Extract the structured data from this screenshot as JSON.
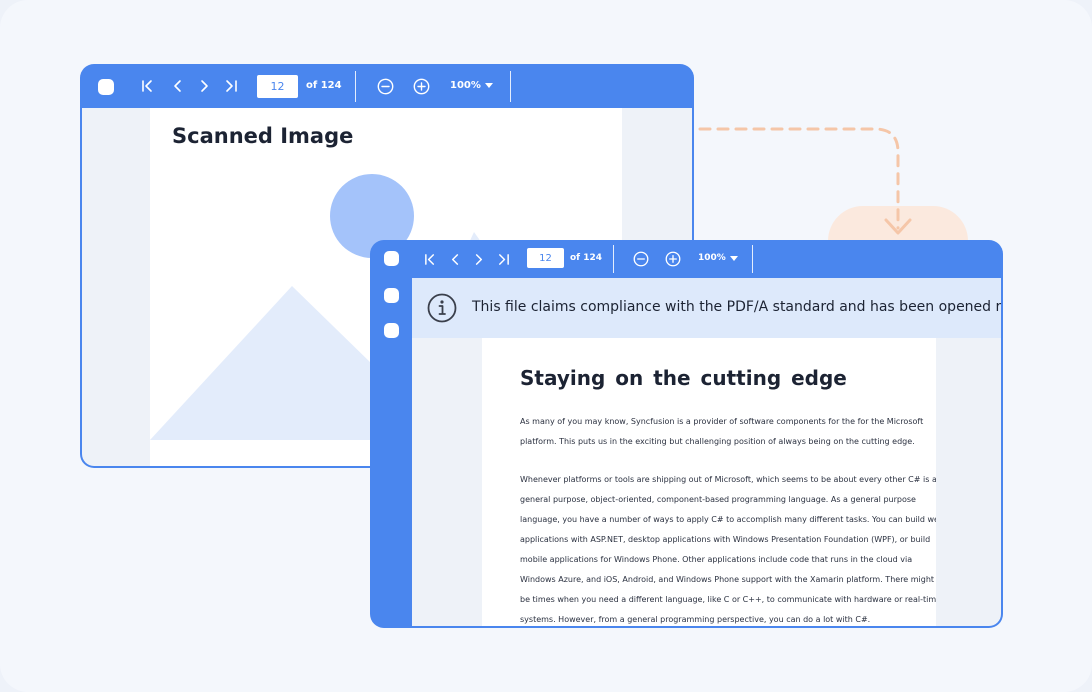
{
  "viewer_back": {
    "toolbar": {
      "page_number": "12",
      "page_total": "of 124",
      "zoom": "100%"
    },
    "page": {
      "title": "Scanned Image"
    }
  },
  "viewer_front": {
    "toolbar": {
      "page_number": "12",
      "page_total": "of 124",
      "zoom": "100%"
    },
    "notification": {
      "text": "This file claims compliance with the PDF/A standard and has been opened r"
    },
    "page": {
      "title": "Staying  on  the cutting  edge",
      "paragraph1": [
        "As many of you may know, Syncfusion is a provider of software components for the for the Microsoft",
        "platform. This puts us in the exciting but challenging position of always being on the cutting edge."
      ],
      "paragraph2": [
        "Whenever platforms or tools are shipping out of Microsoft, which seems to be about every other C# is a",
        "general purpose, object-oriented, component-based programming language. As a general purpose",
        "language, you have a number of ways to apply C# to accomplish many different tasks. You can build web",
        "applications with ASP.NET, desktop applications with Windows Presentation Foundation (WPF), or build",
        "mobile applications for Windows Phone. Other applications include code that runs in the cloud via",
        "Windows Azure, and iOS, Android, and Windows Phone support with the Xamarin platform. There might",
        "be times when you need a different language, like C or C++, to communicate with hardware or real-time",
        "systems. However, from a general programming perspective, you can do a lot with C#."
      ]
    }
  },
  "icons": {
    "first": "first-page-icon",
    "prev": "previous-page-icon",
    "next": "next-page-icon",
    "last": "last-page-icon",
    "zoom_out": "zoom-out-icon",
    "zoom_in": "zoom-in-icon",
    "info": "info-icon"
  },
  "colors": {
    "primary": "#4a86ee",
    "notification_bg": "#dde9fb",
    "accent_connector": "#f5c6a8"
  }
}
